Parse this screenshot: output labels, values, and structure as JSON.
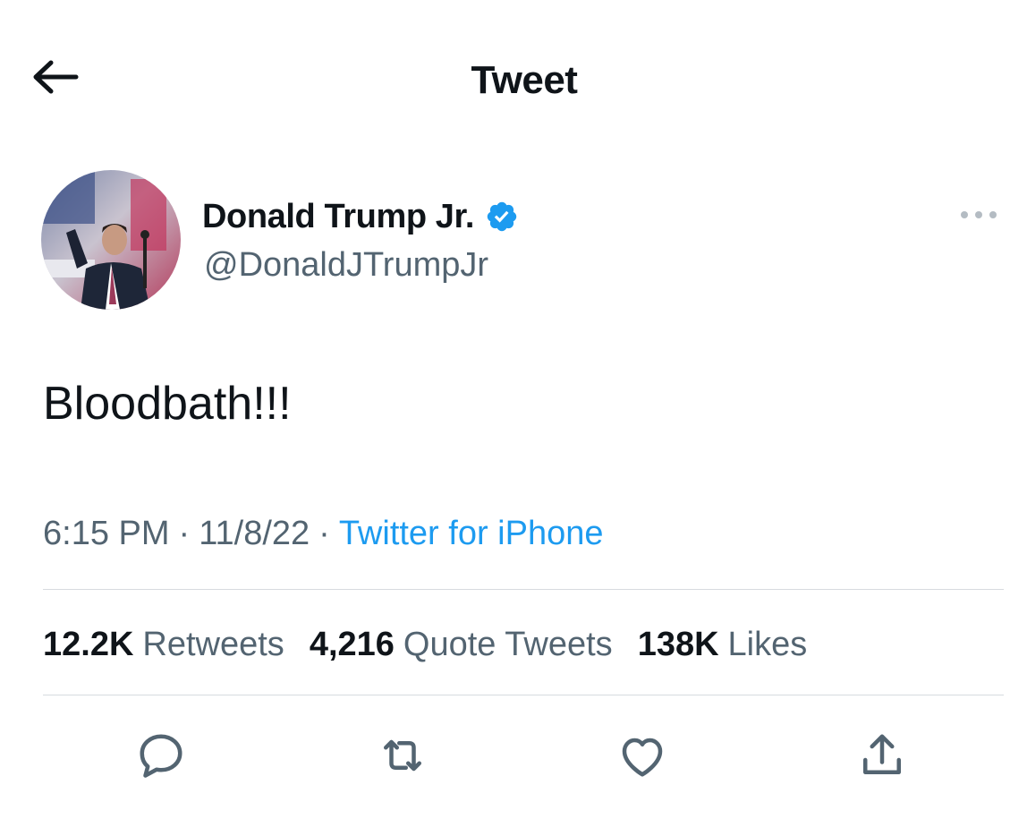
{
  "header": {
    "title": "Tweet",
    "back_icon": "arrow-left-icon"
  },
  "author": {
    "display_name": "Donald Trump Jr.",
    "handle": "@DonaldJTrumpJr",
    "verified": true,
    "verified_color": "#1d9bf0",
    "avatar_icon": "profile-photo"
  },
  "tweet": {
    "text": "Bloodbath!!!",
    "time": "6:15 PM",
    "date": "11/8/22",
    "separator": "·",
    "source": "Twitter for iPhone"
  },
  "stats": {
    "retweets_count": "12.2K",
    "retweets_label": "Retweets",
    "quotes_count": "4,216",
    "quotes_label": "Quote Tweets",
    "likes_count": "138K",
    "likes_label": "Likes"
  },
  "actions": {
    "reply_icon": "reply-icon",
    "retweet_icon": "retweet-icon",
    "like_icon": "heart-icon",
    "share_icon": "share-icon",
    "more_icon": "more-horizontal-icon"
  },
  "colors": {
    "text": "#0f1419",
    "secondary": "#536471",
    "accent": "#1d9bf0",
    "divider": "#d7dbdf"
  }
}
